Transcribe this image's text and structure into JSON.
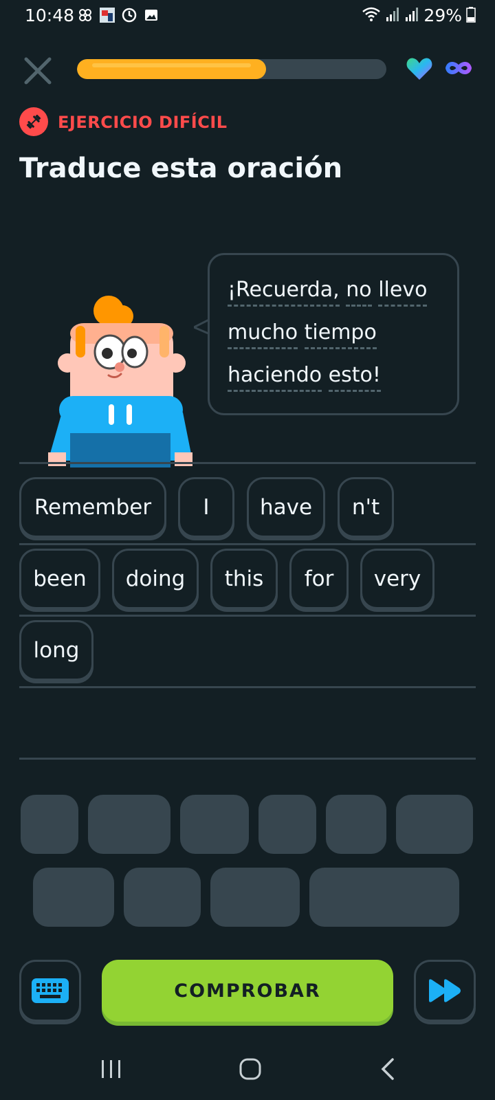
{
  "status_bar": {
    "time": "10:48",
    "battery": "29%",
    "left_icons": [
      "pinwheel-icon",
      "app-notification-icon",
      "sync-icon",
      "gallery-icon"
    ],
    "right_icons": [
      "wifi-icon",
      "signal-icon",
      "signal-icon",
      "battery-icon"
    ]
  },
  "lesson": {
    "progress_fraction": 0.61,
    "hearts": "infinite"
  },
  "exercise": {
    "badge_label": "EJERCICIO DIFÍCIL",
    "title": "Traduce esta oración"
  },
  "speech": {
    "line1": "¡Recuerda, no llevo",
    "line2": "mucho tiempo",
    "line3": "haciendo esto!",
    "words": [
      "¡Recuerda,",
      "no",
      "llevo",
      "mucho",
      "tiempo",
      "haciendo",
      "esto!"
    ]
  },
  "answer_chips": [
    "Remember",
    "I",
    "have",
    "n't",
    "been",
    "doing",
    "this",
    "for",
    "very",
    "long"
  ],
  "bottom": {
    "check_label": "COMPROBAR"
  },
  "colors": {
    "background": "#131f24",
    "border": "#37464f",
    "accent_green": "#93d333",
    "progress_orange": "#ffb020",
    "hard_red": "#ff4b4b",
    "skip_blue": "#1cb0f6"
  }
}
